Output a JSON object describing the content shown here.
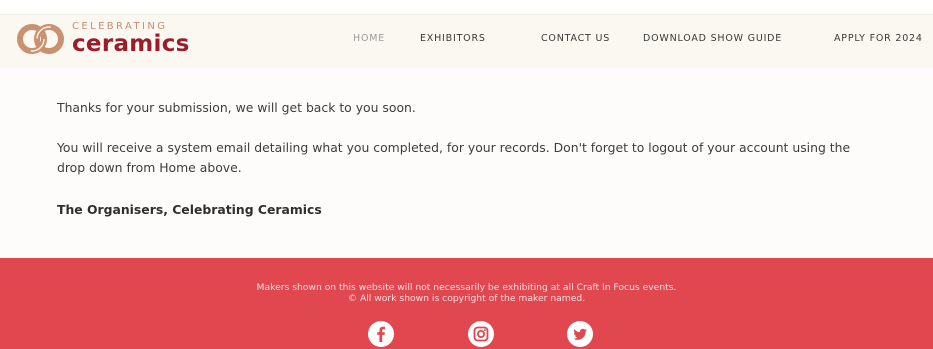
{
  "header": {
    "logo": {
      "small_text": "CELEBRATING",
      "big_text": "ceramics",
      "icon": "ceramics-rings-logo-icon",
      "colors": {
        "rings": "#c9916f",
        "text": "#9c1d2a"
      }
    },
    "nav": [
      {
        "label": "HOME",
        "active": true
      },
      {
        "label": "EXHIBITORS",
        "active": false
      },
      {
        "label": "CONTACT US",
        "active": false
      },
      {
        "label": "DOWNLOAD SHOW GUIDE",
        "active": false
      },
      {
        "label": "APPLY FOR 2024",
        "active": false
      }
    ]
  },
  "main": {
    "paragraphs": [
      "Thanks for your submission, we will get back to you soon.",
      "You will receive a system email detailing what you completed, for your records. Don't forget to logout of your account using the drop down from Home above.",
      "The Organisers, Celebrating Ceramics"
    ]
  },
  "footer": {
    "lines": [
      "Makers shown on this website will not necessarily be exhibiting at all Craft In Focus events.",
      "© All work shown is copyright of the maker named."
    ],
    "social": [
      {
        "icon": "facebook-icon"
      },
      {
        "icon": "instagram-icon"
      },
      {
        "icon": "twitter-icon"
      }
    ],
    "background": "#e1474f"
  }
}
